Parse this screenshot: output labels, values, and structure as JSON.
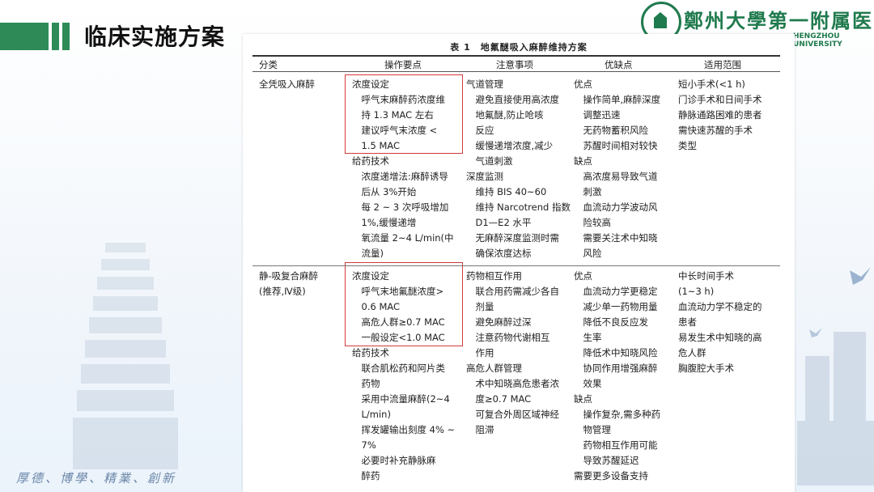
{
  "slide": {
    "title": "临床实施方案",
    "logo_text": "鄭州大學第一附属医院",
    "logo_en": "HENGZHOU UNIVERSITY",
    "motto": "厚德、博學、精業、創新"
  },
  "table": {
    "caption": "表 1　地氟醚吸入麻醉维持方案",
    "headers": [
      "分类",
      "操作要点",
      "注意事项",
      "优缺点",
      "适用范围"
    ],
    "rows": [
      {
        "category": [
          "全凭吸入麻醉"
        ],
        "operation": [
          "浓度设定",
          "　呼气末麻醉药浓度维",
          "　持 1.3 MAC 左右",
          "　建议呼气末浓度 <",
          "　1.5 MAC",
          "给药技术",
          "　浓度递增法:麻醉诱导",
          "　后从 3%开始",
          "　每 2 ~ 3 次呼吸增加",
          "　1%,缓慢递增",
          "　氧流量 2~4 L/min(中",
          "　流量)"
        ],
        "notes": [
          "气道管理",
          "　避免直接使用高浓度",
          "　地氟醚,防止呛咳",
          "　反应",
          "　缓慢递增浓度,减少",
          "　气道刺激",
          "深度监测",
          "　维持 BIS 40~60",
          "　维持 Narcotrend 指数",
          "　D1—E2 水平",
          "　无麻醉深度监测时需",
          "　确保浓度达标"
        ],
        "pros_cons": [
          "优点",
          "　操作简单,麻醉深度",
          "　调整迅速",
          "　无药物蓄积风险",
          "　苏醒时间相对较快",
          "缺点",
          "　高浓度易导致气道",
          "　刺激",
          "　血流动力学波动风",
          "　险较高",
          "　需要关注术中知晓",
          "　风险"
        ],
        "scope": [
          "短小手术(<1 h)",
          "门诊手术和日间手术",
          "静脉通路困难的患者",
          "需快速苏醒的手术",
          "类型"
        ]
      },
      {
        "category": [
          "静-吸复合麻醉",
          "(推荐,Ⅳ级)"
        ],
        "operation": [
          "浓度设定",
          "　呼气末地氟醚浓度>",
          "　0.6 MAC",
          "　高危人群≥0.7 MAC",
          "　一般设定<1.0 MAC",
          "给药技术",
          "　联合肌松药和阿片类",
          "　药物",
          "　采用中流量麻醉(2~4",
          "　L/min)",
          "　挥发罐输出刻度 4% ~",
          "　7%",
          "　必要时补充静脉麻",
          "　醉药"
        ],
        "notes": [
          "药物相互作用",
          "　联合用药需减少各自",
          "　剂量",
          "　避免麻醉过深",
          "　注意药物代谢相互",
          "　作用",
          "高危人群管理",
          "　术中知晓高危患者浓",
          "　度≥0.7 MAC",
          "　可复合外周区域神经",
          "　阻滞"
        ],
        "pros_cons": [
          "优点",
          "　血流动力学更稳定",
          "　减少单一药物用量",
          "　降低不良反应发",
          "　生率",
          "　降低术中知晓风险",
          "　协同作用增强麻醉",
          "　效果",
          "缺点",
          "　操作复杂,需多种药",
          "　物管理",
          "　药物相互作用可能",
          "　导致苏醒延迟",
          "需要更多设备支持"
        ],
        "scope": [
          "中长时间手术",
          "(1~3 h)",
          "血流动力学不稳定的",
          "患者",
          "易发生术中知晓的高",
          "危人群",
          "胸腹腔大手术"
        ]
      }
    ]
  },
  "colors": {
    "accent_green": "#2e8b57",
    "highlight_red": "#d23a3a"
  }
}
